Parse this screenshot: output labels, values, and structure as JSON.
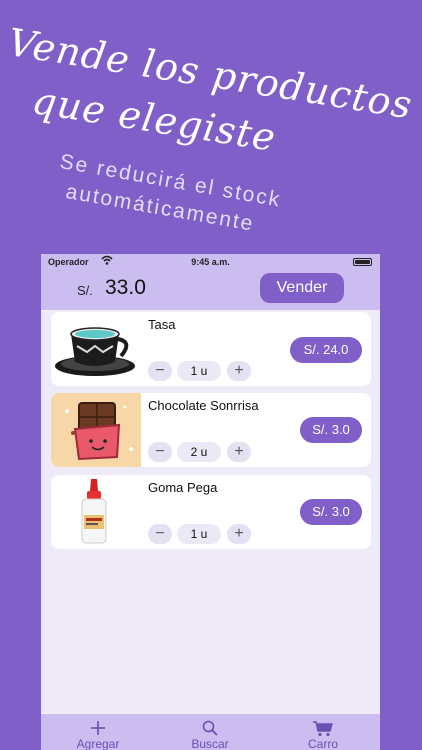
{
  "promo": {
    "headline_line1": "Vende los productos",
    "headline_line2": "que elegiste",
    "sub_line1": "Se reducirá el stock",
    "sub_line2": "automáticamente"
  },
  "status_bar": {
    "carrier": "Operador",
    "time": "9:45 a.m."
  },
  "header": {
    "currency": "S/.",
    "total": "33.0",
    "sell_button": "Vender"
  },
  "cart_items": [
    {
      "name": "Tasa",
      "quantity": "1 u",
      "price": "S/. 24.0",
      "image": "teacup-image"
    },
    {
      "name": "Chocolate Sonrrisa",
      "quantity": "2 u",
      "price": "S/. 3.0",
      "image": "chocolate-bar-image"
    },
    {
      "name": "Goma Pega",
      "quantity": "1 u",
      "price": "S/. 3.0",
      "image": "glue-bottle-image"
    }
  ],
  "stepper_glyphs": {
    "minus": "−",
    "plus": "+"
  },
  "tab_bar": [
    {
      "label": "Agregar",
      "icon": "plus-icon"
    },
    {
      "label": "Buscar",
      "icon": "search-icon"
    },
    {
      "label": "Carro",
      "icon": "cart-icon"
    }
  ],
  "colors": {
    "background": "#8060c8",
    "accent": "#8060c8",
    "bar": "#cbbdf0",
    "screen": "#efeaf8"
  }
}
